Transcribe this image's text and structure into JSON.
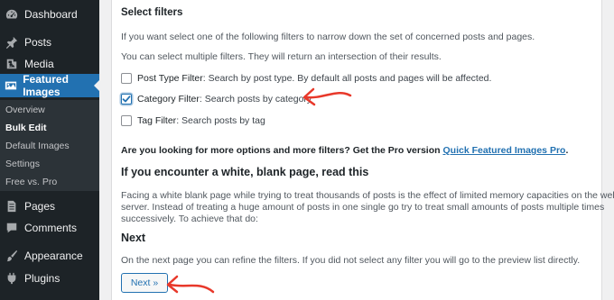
{
  "sidebar": {
    "items": [
      {
        "label": "Dashboard",
        "icon": "dashboard-icon"
      },
      {
        "label": "Posts",
        "icon": "pin-icon"
      },
      {
        "label": "Media",
        "icon": "media-icon"
      },
      {
        "label": "Featured Images",
        "icon": "image-icon",
        "current": true
      },
      {
        "label": "Pages",
        "icon": "page-icon"
      },
      {
        "label": "Comments",
        "icon": "comment-icon"
      },
      {
        "label": "Appearance",
        "icon": "brush-icon"
      },
      {
        "label": "Plugins",
        "icon": "plug-icon"
      }
    ],
    "submenu": [
      "Overview",
      "Bulk Edit",
      "Default Images",
      "Settings",
      "Free vs. Pro"
    ],
    "submenu_current": "Bulk Edit"
  },
  "main": {
    "select_filters_title": "Select filters",
    "intro_text": "If you want select one of the following filters to narrow down the set of concerned posts and pages.",
    "multiple_text": "You can select multiple filters. They will return an intersection of their results.",
    "filters": [
      {
        "label": "Post Type Filter",
        "description": ": Search by post type. By default all posts and pages will be affected.",
        "checked": false
      },
      {
        "label": "Category Filter",
        "description": ": Search posts by category",
        "checked": true
      },
      {
        "label": "Tag Filter",
        "description": ": Search posts by tag",
        "checked": false
      }
    ],
    "promo_text": "Are you looking for more options and more filters? Get the Pro version",
    "promo_link": "Quick Featured Images Pro",
    "promo_end": ".",
    "blank_page_title": "If you encounter a white, blank page, read this",
    "blank_page_text_1": "Facing a white blank page while trying to treat thousands of posts is the effect of limited memory capacities on the website",
    "blank_page_text_2": "server. Instead of treating a huge amount of posts in one single go try to treat small amounts of posts multiple times",
    "blank_page_text_3": "successively. To achieve that do:",
    "next_title": "Next",
    "next_text": "On the next page you can refine the filters. If you did not select any filter you will go to the preview list directly.",
    "next_button": "Next »"
  },
  "colors": {
    "sidebar_bg": "#1d2327",
    "accent": "#2271b1",
    "annotation_arrow": "#e8382a"
  }
}
